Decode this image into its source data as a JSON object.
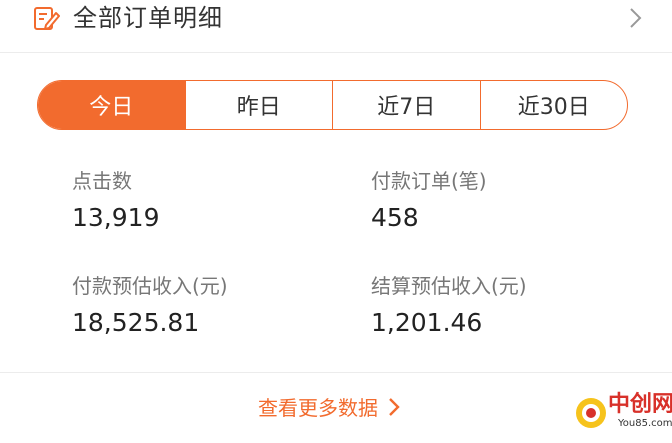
{
  "header": {
    "title": "全部订单明细",
    "icon": "edit-document-icon",
    "chevron": "chevron-right-icon"
  },
  "tabs": [
    {
      "label": "今日",
      "active": true
    },
    {
      "label": "昨日",
      "active": false
    },
    {
      "label": "近7日",
      "active": false
    },
    {
      "label": "近30日",
      "active": false
    }
  ],
  "stats": {
    "clicks": {
      "label": "点击数",
      "value": "13,919"
    },
    "paid_orders": {
      "label": "付款订单(笔)",
      "value": "458"
    },
    "paid_income": {
      "label": "付款预估收入(元)",
      "value": "18,525.81"
    },
    "settled_income": {
      "label": "结算预估收入(元)",
      "value": "1,201.46"
    }
  },
  "footer": {
    "more_label": "查看更多数据"
  },
  "watermark": {
    "text": "中创网",
    "sub": "You85.com"
  },
  "colors": {
    "accent": "#f26b2e",
    "watermark_red": "#d8312a",
    "watermark_yellow": "#f6c31c"
  }
}
